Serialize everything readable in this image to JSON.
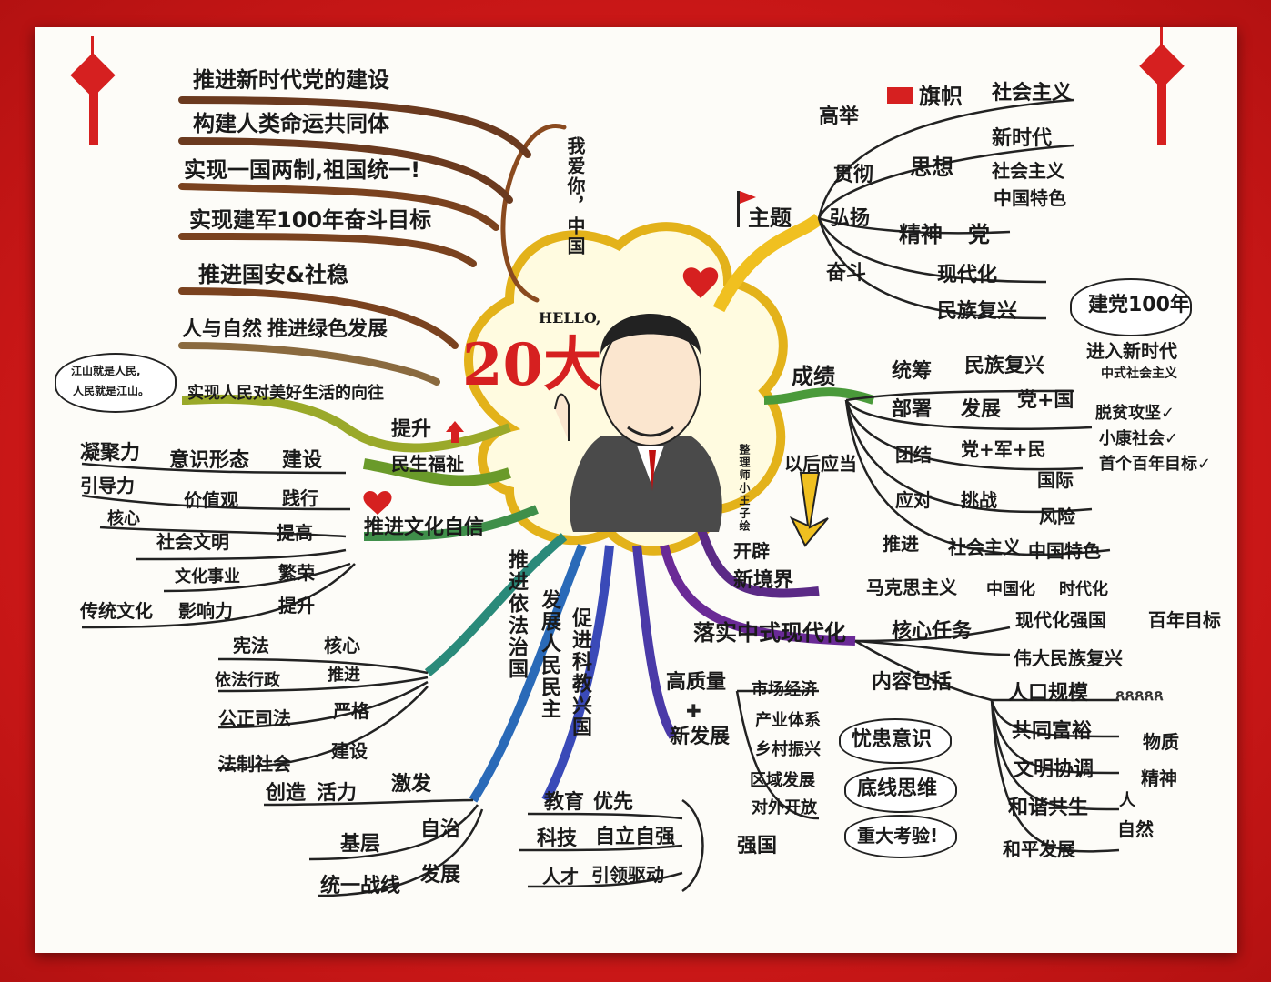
{
  "colors": {
    "frame": "#d61f1f",
    "paper": "#fdfcf8",
    "gold": "#e3b21a",
    "red": "#d62020",
    "purple": "#5b2a86",
    "blue": "#2e59b8",
    "green": "#6a9a2a",
    "brown": "#6b3a1f"
  },
  "center": {
    "title": "20大",
    "hello": "HELLO,",
    "vertical": "我爱你，中国",
    "credit": "整理师小王子绘"
  },
  "left_top": [
    "推进新时代党的建设",
    "构建人类命运共同体",
    "实现一国两制,祖国统一!",
    "实现建军100年奋斗目标",
    "推进国安&社稳"
  ],
  "nature": {
    "a": "人与自然",
    "b": "推进绿色发展"
  },
  "people": {
    "bubble_l1": "江山就是人民,",
    "bubble_l2": "人民就是江山。",
    "goal": "实现人民对美好生活的向往",
    "raise": "提升",
    "welfare": "民生福祉"
  },
  "culture": {
    "rows": [
      [
        "凝聚力",
        "意识形态",
        "建设"
      ],
      [
        "引导力",
        "价值观",
        "践行"
      ],
      [
        "核心",
        "社会文明",
        "提高"
      ],
      [
        "",
        "文化事业",
        "繁荣"
      ],
      [
        "传统文化",
        "影响力",
        "提升"
      ]
    ],
    "branch": "推进文化自信"
  },
  "law": {
    "branch": "推进依法治国",
    "rows": [
      [
        "宪法",
        "核心"
      ],
      [
        "依法行政",
        "推进"
      ],
      [
        "公正司法",
        "严格"
      ],
      [
        "法制社会",
        "建设"
      ]
    ]
  },
  "democracy": {
    "branch": "发展人民民主",
    "rows": [
      [
        "创造",
        "活力"
      ],
      [
        "基层",
        "自治"
      ],
      [
        "统一战线",
        "发展"
      ]
    ],
    "spark": "激发"
  },
  "science": {
    "branch": "促进科教兴国",
    "rows": [
      [
        "教育",
        "优先"
      ],
      [
        "科技",
        "自立自强"
      ],
      [
        "人才",
        "引领驱动"
      ]
    ],
    "strong": "强国"
  },
  "theme": {
    "label": "主题",
    "rows": [
      [
        "高举",
        "旗帜",
        "社会主义"
      ],
      [
        "贯彻",
        "思想",
        "新时代"
      ],
      [
        "",
        "",
        "社会主义"
      ],
      [
        "",
        "",
        "中国特色"
      ],
      [
        "弘扬",
        "精神",
        "党"
      ],
      [
        "奋斗",
        "",
        "现代化"
      ],
      [
        "",
        "",
        "民族复兴"
      ]
    ]
  },
  "achieve": {
    "label": "成绩",
    "rows": [
      [
        "统筹",
        "民族复兴"
      ],
      [
        "部署",
        "发展",
        "党+国"
      ],
      [
        "团结",
        "党+军+民"
      ],
      [
        "应对",
        "挑战",
        "国际"
      ],
      [
        "",
        "",
        "风险"
      ],
      [
        "推进",
        "社会主义",
        "中国特色"
      ]
    ],
    "bubble": "建党100年",
    "new_era": "进入新时代",
    "ch": "中式社会主义",
    "list": [
      "脱贫攻坚✓",
      "小康社会✓",
      "首个百年目标✓"
    ]
  },
  "future": {
    "label": "以后应当",
    "open": "开辟",
    "new": "新境界",
    "marx": "马克思主义",
    "cn": "中国化",
    "era": "时代化"
  },
  "modern": {
    "branch": "落实中式现代化",
    "core": "核心任务",
    "goal1": "现代化强国",
    "goal2": "百年目标",
    "goal3": "伟大民族复兴",
    "content": "内容包括",
    "items": [
      [
        "人口规模",
        ""
      ],
      [
        "共同富裕",
        ""
      ],
      [
        "文明协调",
        "物质"
      ],
      [
        "",
        "精神"
      ],
      [
        "和谐共生",
        "人"
      ],
      [
        "",
        "自然"
      ],
      [
        "和平发展",
        ""
      ]
    ],
    "icons": "ጸጸጸጸጸ"
  },
  "quality": {
    "label1": "高质量",
    "plus": "✚",
    "label2": "新发展",
    "items": [
      "市场经济",
      "产业体系",
      "乡村振兴",
      "区域发展",
      "对外开放"
    ],
    "bubbles": [
      "忧患意识",
      "底线思维",
      "重大考验!"
    ]
  }
}
